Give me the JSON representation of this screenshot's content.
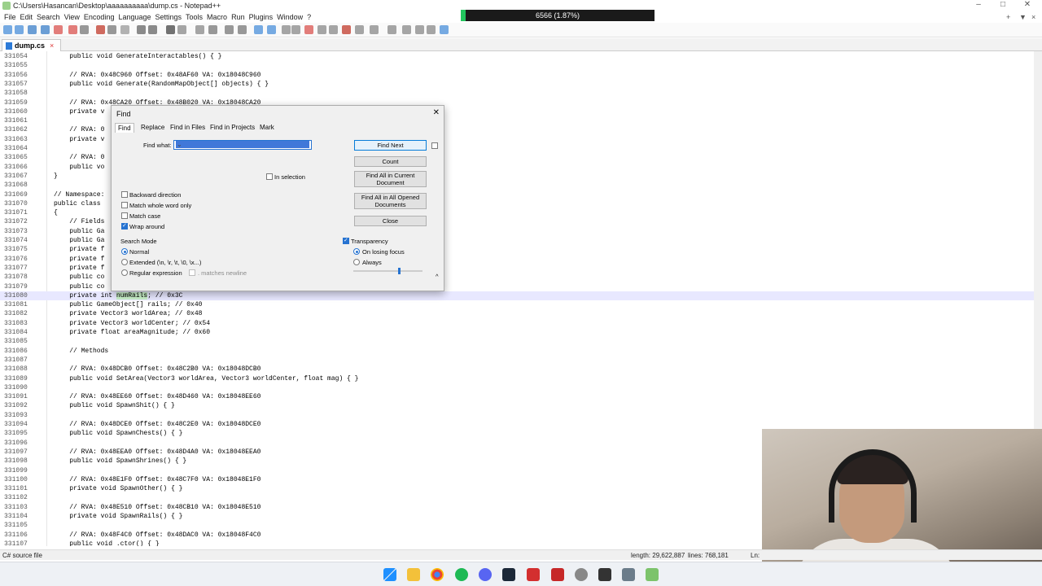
{
  "window": {
    "title": "C:\\Users\\Hasancan\\Desktop\\aaaaaaaaaa\\dump.cs - Notepad++"
  },
  "perf_overlay": {
    "text": "6566 (1.87%)"
  },
  "menu": [
    "File",
    "Edit",
    "Search",
    "View",
    "Encoding",
    "Language",
    "Settings",
    "Tools",
    "Macro",
    "Run",
    "Plugins",
    "Window",
    "?"
  ],
  "menu_right": {
    "add": "+",
    "dropdown": "▼",
    "close": "×"
  },
  "tab": {
    "label": "dump.cs",
    "close": "×"
  },
  "editor": {
    "lines": [
      {
        "n": "331054",
        "t": "    public void GenerateInteractables() { }"
      },
      {
        "n": "331055",
        "t": ""
      },
      {
        "n": "331056",
        "t": "    // RVA: 0x48C960 Offset: 0x48AF60 VA: 0x18048C960"
      },
      {
        "n": "331057",
        "t": "    public void Generate(RandomMapObject[] objects) { }"
      },
      {
        "n": "331058",
        "t": ""
      },
      {
        "n": "331059",
        "t": "    // RVA: 0x48CA20 Offset: 0x48B020 VA: 0x18048CA20"
      },
      {
        "n": "331060",
        "t": "    private v"
      },
      {
        "n": "331061",
        "t": ""
      },
      {
        "n": "331062",
        "t": "    // RVA: 0"
      },
      {
        "n": "331063",
        "t": "    private v"
      },
      {
        "n": "331064",
        "t": ""
      },
      {
        "n": "331065",
        "t": "    // RVA: 0"
      },
      {
        "n": "331066",
        "t": "    public vo"
      },
      {
        "n": "331067",
        "t": "}"
      },
      {
        "n": "331068",
        "t": ""
      },
      {
        "n": "331069",
        "t": "// Namespace:"
      },
      {
        "n": "331070",
        "t": "public class"
      },
      {
        "n": "331071",
        "t": "{"
      },
      {
        "n": "331072",
        "t": "    // Fields"
      },
      {
        "n": "331073",
        "t": "    public Ga"
      },
      {
        "n": "331074",
        "t": "    public Ga"
      },
      {
        "n": "331075",
        "t": "    private f"
      },
      {
        "n": "331076",
        "t": "    private f"
      },
      {
        "n": "331077",
        "t": "    private f"
      },
      {
        "n": "331078",
        "t": "    public co"
      },
      {
        "n": "331079",
        "t": "    public co"
      },
      {
        "n": "331080",
        "t": "    private int numRails; // 0x3C"
      },
      {
        "n": "331081",
        "t": "    public GameObject[] rails; // 0x40"
      },
      {
        "n": "331082",
        "t": "    private Vector3 worldArea; // 0x48"
      },
      {
        "n": "331083",
        "t": "    private Vector3 worldCenter; // 0x54"
      },
      {
        "n": "331084",
        "t": "    private float areaMagnitude; // 0x60"
      },
      {
        "n": "331085",
        "t": ""
      },
      {
        "n": "331086",
        "t": "    // Methods"
      },
      {
        "n": "331087",
        "t": ""
      },
      {
        "n": "331088",
        "t": "    // RVA: 0x48DCB0 Offset: 0x48C2B0 VA: 0x18048DCB0"
      },
      {
        "n": "331089",
        "t": "    public void SetArea(Vector3 worldArea, Vector3 worldCenter, float mag) { }"
      },
      {
        "n": "331090",
        "t": ""
      },
      {
        "n": "331091",
        "t": "    // RVA: 0x48EE60 Offset: 0x48D460 VA: 0x18048EE60"
      },
      {
        "n": "331092",
        "t": "    public void SpawnShit() { }"
      },
      {
        "n": "331093",
        "t": ""
      },
      {
        "n": "331094",
        "t": "    // RVA: 0x48DCE0 Offset: 0x48C2E0 VA: 0x18048DCE0"
      },
      {
        "n": "331095",
        "t": "    public void SpawnChests() { }"
      },
      {
        "n": "331096",
        "t": ""
      },
      {
        "n": "331097",
        "t": "    // RVA: 0x48EEA0 Offset: 0x48D4A0 VA: 0x18048EEA0"
      },
      {
        "n": "331098",
        "t": "    public void SpawnShrines() { }"
      },
      {
        "n": "331099",
        "t": ""
      },
      {
        "n": "331100",
        "t": "    // RVA: 0x48E1F0 Offset: 0x48C7F0 VA: 0x18048E1F0"
      },
      {
        "n": "331101",
        "t": "    private void SpawnOther() { }"
      },
      {
        "n": "331102",
        "t": ""
      },
      {
        "n": "331103",
        "t": "    // RVA: 0x48E510 Offset: 0x48CB10 VA: 0x18048E510"
      },
      {
        "n": "331104",
        "t": "    private void SpawnRails() { }"
      },
      {
        "n": "331105",
        "t": ""
      },
      {
        "n": "331106",
        "t": "    // RVA: 0x48F4C0 Offset: 0x48DAC0 VA: 0x18048F4C0"
      },
      {
        "n": "331107",
        "t": "    public void .ctor() { }"
      }
    ],
    "highlight_line": 26,
    "search_hit": "numRails"
  },
  "find_dialog": {
    "title": "Find",
    "close": "✕",
    "tabs": [
      "Find",
      "Replace",
      "Find in Files",
      "Find in Projects",
      "Mark"
    ],
    "find_what_label": "Find what:",
    "find_what_value": "numRails",
    "in_selection": "In selection",
    "buttons": {
      "find_next": "Find Next",
      "count": "Count",
      "find_all_current": "Find All in Current Document",
      "find_all_opened": "Find All in All Opened Documents",
      "close": "Close"
    },
    "options": {
      "backward": "Backward direction",
      "whole_word": "Match whole word only",
      "match_case": "Match case",
      "wrap": "Wrap around"
    },
    "search_mode": {
      "label": "Search Mode",
      "normal": "Normal",
      "extended": "Extended (\\n, \\r, \\t, \\0, \\x...)",
      "regex": "Regular expression",
      "matches_newline": ". matches newline"
    },
    "transparency": {
      "label": "Transparency",
      "on_losing_focus": "On losing focus",
      "always": "Always"
    },
    "up_arrow": "^"
  },
  "status": {
    "file_type": "C# source file",
    "length": "length: 29,622,887",
    "lines": "lines: 768,181",
    "ln": "Ln:"
  }
}
